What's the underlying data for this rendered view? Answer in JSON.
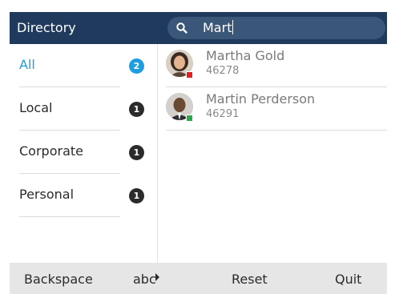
{
  "header": {
    "title": "Directory",
    "search_value": "Mart"
  },
  "categories": [
    {
      "label": "All",
      "count": "2",
      "active": true
    },
    {
      "label": "Local",
      "count": "1",
      "active": false
    },
    {
      "label": "Corporate",
      "count": "1",
      "active": false
    },
    {
      "label": "Personal",
      "count": "1",
      "active": false
    }
  ],
  "contacts": [
    {
      "name": "Martha Gold",
      "ext": "46278",
      "presence_color": "#e02020",
      "avatar": "female-avatar"
    },
    {
      "name": "Martin Perderson",
      "ext": "46291",
      "presence_color": "#2ea84a",
      "avatar": "male-avatar"
    }
  ],
  "softkeys": {
    "backspace": "Backspace",
    "abc": "abc",
    "reset": "Reset",
    "quit": "Quit"
  },
  "colors": {
    "header_bg": "#1f3a5c",
    "accent": "#1e9de0",
    "softkey_bg": "#e6e6e6"
  }
}
